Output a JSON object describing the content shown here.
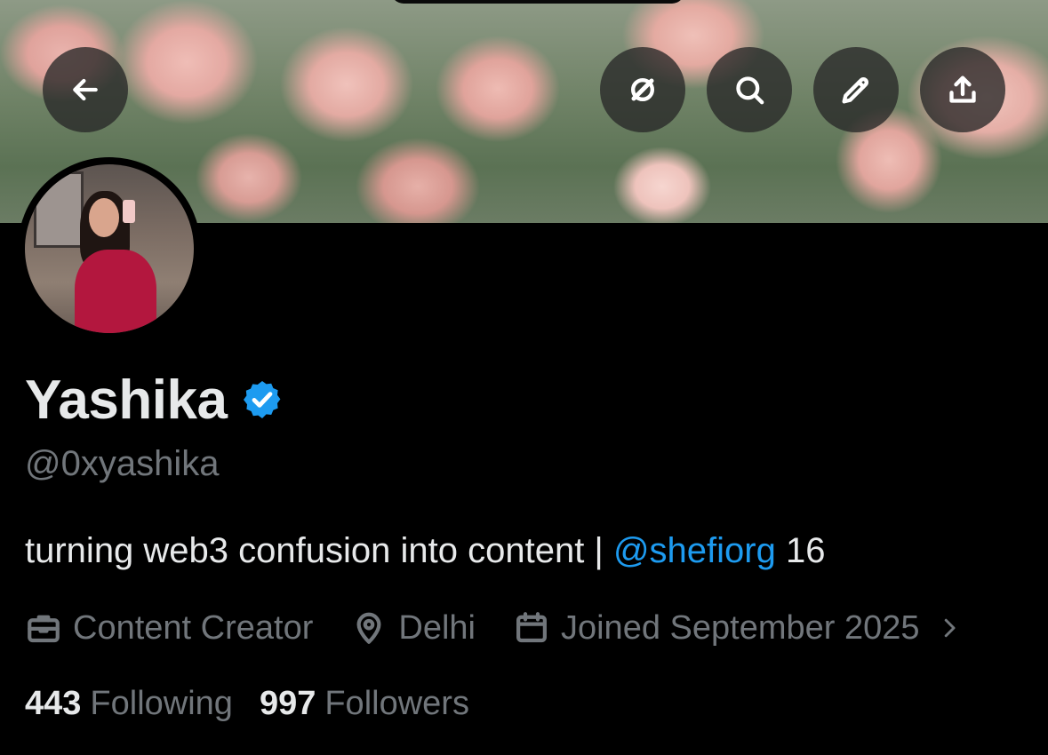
{
  "profile": {
    "name": "Yashika",
    "handle": "@0xyashika",
    "bio_text": "turning web3 confusion into content | ",
    "bio_mention": "@shefiorg",
    "bio_suffix": " 16",
    "category": "Content Creator",
    "location": "Delhi",
    "joined": "Joined September 2025",
    "following_count": "443",
    "following_label": "Following",
    "followers_count": "997",
    "followers_label": "Followers"
  },
  "icons": {
    "back": "arrow-left-icon",
    "grok": "grok-icon",
    "search": "search-icon",
    "edit": "pencil-icon",
    "share": "share-icon",
    "category": "briefcase-icon",
    "location": "location-pin-icon",
    "joined": "calendar-icon",
    "verified": "verified-badge-icon"
  },
  "colors": {
    "background": "#000000",
    "text_primary": "#e7e9ea",
    "text_secondary": "#71767b",
    "accent": "#1d9bf0",
    "button_bg": "rgba(40,40,40,0.78)"
  }
}
